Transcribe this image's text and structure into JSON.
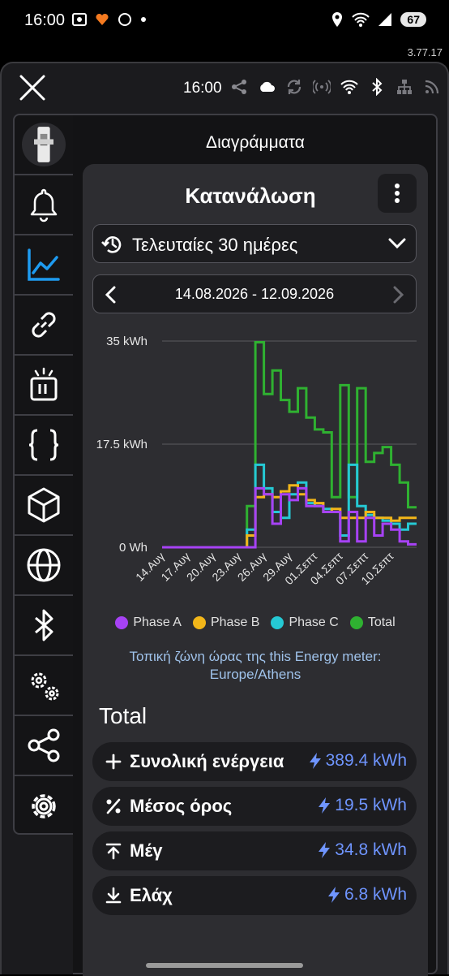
{
  "status_bar": {
    "time": "16:00",
    "battery": "67"
  },
  "app_version": "3.77.17",
  "topbar": {
    "time": "16:00"
  },
  "page_title": "Διαγράμματα",
  "card": {
    "title": "Κατανάλωση",
    "period_label": "Τελευταίες 30 ημέρες",
    "date_range": "14.08.2026 - 12.09.2026",
    "timezone_note": "Τοπική ζώνη ώρας της this Energy meter: Europe/Athens"
  },
  "chart_data": {
    "type": "line",
    "step": true,
    "y_ticks": [
      "35 kWh",
      "17.5 kWh",
      "0 Wh"
    ],
    "ylim": [
      0,
      35
    ],
    "x_ticks": [
      "14.Αυγ",
      "17.Αυγ",
      "20.Αυγ",
      "23.Αυγ",
      "26.Αυγ",
      "29.Αυγ",
      "01.Σεπτ",
      "04.Σεπτ",
      "07.Σεπτ",
      "10.Σεπτ"
    ],
    "n_days": 30,
    "series": [
      {
        "name": "Phase A",
        "color": "#a742f5",
        "values": [
          0,
          0,
          0,
          0,
          0,
          0,
          0,
          0,
          0,
          0,
          0,
          10,
          9,
          4,
          9,
          8,
          10,
          7,
          7,
          6,
          6,
          1,
          6,
          1,
          5,
          2,
          4,
          3,
          1,
          0.5
        ]
      },
      {
        "name": "Phase B",
        "color": "#f2b619",
        "values": [
          0,
          0,
          0,
          0,
          0,
          0,
          0,
          0,
          0,
          0,
          2,
          8.5,
          9,
          8.5,
          9.5,
          10.5,
          9,
          8,
          7.5,
          6,
          6.5,
          5,
          5,
          5,
          6,
          5,
          5,
          4.5,
          5,
          5
        ]
      },
      {
        "name": "Phase C",
        "color": "#25c9d4",
        "values": [
          0,
          0,
          0,
          0,
          0,
          0,
          0,
          0,
          0,
          0,
          3,
          14,
          10,
          6,
          5,
          9,
          11,
          7.5,
          7,
          6.5,
          6,
          2,
          14,
          7,
          5.5,
          5,
          4.5,
          4,
          3,
          4
        ]
      },
      {
        "name": "Total",
        "color": "#2fb131",
        "values": [
          0,
          0,
          0,
          0,
          0,
          0,
          0,
          0,
          0,
          0,
          7,
          34.8,
          26,
          30,
          25,
          23,
          27,
          22,
          20,
          19.5,
          8.5,
          27.5,
          8.5,
          27,
          14.5,
          16,
          17,
          14,
          11,
          6.8
        ]
      }
    ],
    "legend": [
      "Phase A",
      "Phase B",
      "Phase C",
      "Total"
    ]
  },
  "total": {
    "title": "Total",
    "items": [
      {
        "icon": "plus-icon",
        "label": "Συνολική ενέργεια",
        "value": "389.4 kWh"
      },
      {
        "icon": "percent-icon",
        "label": "Μέσος όρος",
        "value": "19.5 kWh"
      },
      {
        "icon": "max-icon",
        "label": "Μέγ",
        "value": "34.8 kWh"
      },
      {
        "icon": "min-icon",
        "label": "Ελάχ",
        "value": "6.8 kWh"
      }
    ]
  }
}
